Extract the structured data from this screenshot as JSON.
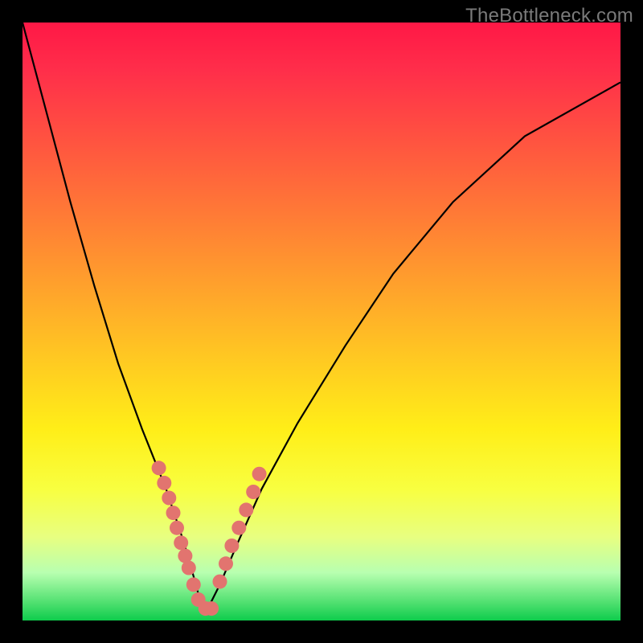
{
  "watermark": "TheBottleneck.com",
  "colors": {
    "background": "#000000",
    "gradient_top": "#ff1846",
    "gradient_mid": "#ffee18",
    "gradient_bottom": "#0ecc4c",
    "curve": "#000000",
    "marker_fill": "#e2746f",
    "marker_stroke": "#c95550"
  },
  "chart_data": {
    "type": "line",
    "title": "",
    "xlabel": "",
    "ylabel": "",
    "xlim": [
      0,
      100
    ],
    "ylim": [
      0,
      100
    ],
    "grid": false,
    "legend": false,
    "annotations": [
      "TheBottleneck.com"
    ],
    "series": [
      {
        "name": "bottleneck-curve",
        "x": [
          0,
          4,
          8,
          12,
          16,
          20,
          24,
          27,
          29,
          30,
          31,
          33,
          36,
          40,
          46,
          54,
          62,
          72,
          84,
          100
        ],
        "y": [
          100,
          85,
          70,
          56,
          43,
          32,
          22,
          13,
          6,
          2,
          2,
          6,
          13,
          22,
          33,
          46,
          58,
          70,
          81,
          90
        ]
      }
    ],
    "markers": {
      "name": "highlight-points",
      "x": [
        22.8,
        23.7,
        24.5,
        25.2,
        25.8,
        26.5,
        27.2,
        27.8,
        28.6,
        29.4,
        30.6,
        31.6,
        33.0,
        34.0,
        35.0,
        36.2,
        37.4,
        38.6,
        39.6
      ],
      "y": [
        25.5,
        23.0,
        20.5,
        18.0,
        15.5,
        13.0,
        10.8,
        8.8,
        6.0,
        3.5,
        2.0,
        2.0,
        6.5,
        9.5,
        12.5,
        15.5,
        18.5,
        21.5,
        24.5
      ]
    }
  }
}
